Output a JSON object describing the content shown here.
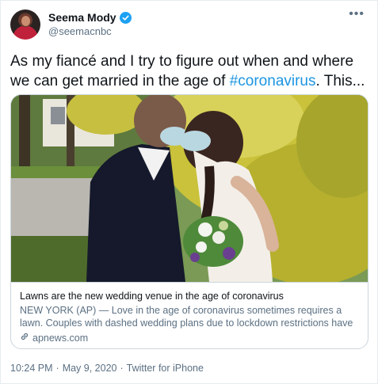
{
  "author": {
    "display_name": "Seema Mody",
    "handle": "@seemacnbc",
    "verified": true,
    "avatar_icon": "profile-photo"
  },
  "tweet": {
    "text_before": "As my fiancé and I try to figure out when and where we can get married in the age of ",
    "hashtag": "#coronavirus",
    "text_after": ". This..."
  },
  "card": {
    "title": "Lawns are the new wedding venue in the age of coronavirus",
    "description": "NEW YORK (AP) — Love in the age of coronavirus sometimes requires a lawn. Couples with dashed wedding plans due to lockdown restrictions have been ...",
    "domain": "apnews.com"
  },
  "meta": {
    "time": "10:24 PM",
    "separator1": "·",
    "date": "May 9, 2020",
    "separator2": "·",
    "source": "Twitter for iPhone"
  },
  "colors": {
    "accent": "#1da1f2",
    "hashtag": "#1b95e0",
    "secondary_text": "#5b7083"
  }
}
